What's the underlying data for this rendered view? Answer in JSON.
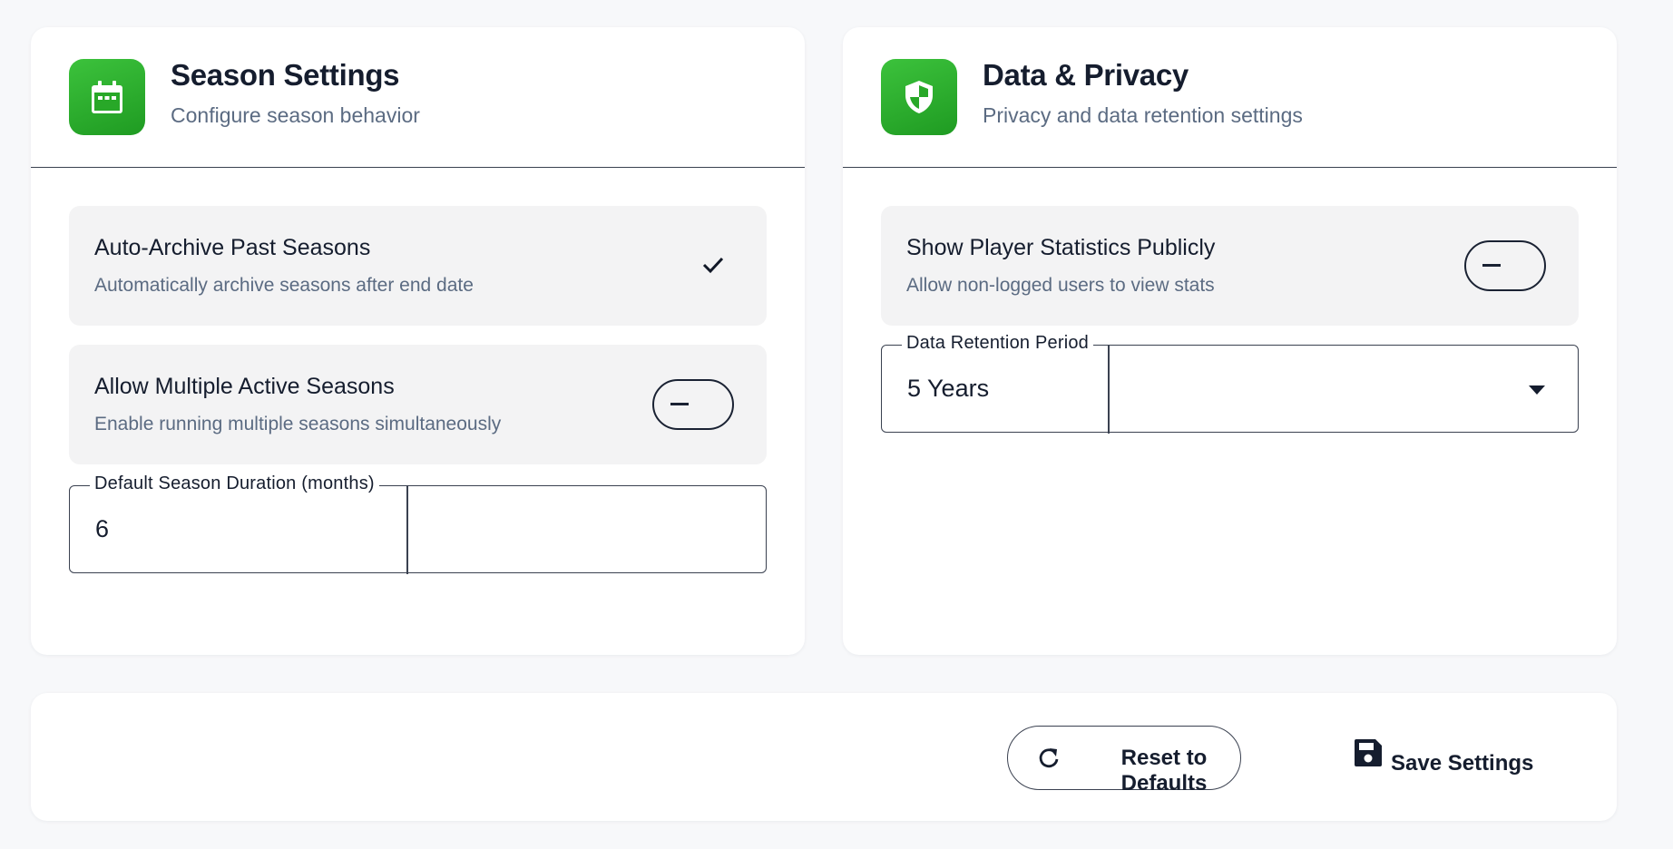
{
  "season_settings": {
    "title": "Season Settings",
    "subtitle": "Configure season behavior",
    "icon": "calendar-icon",
    "auto_archive": {
      "label": "Auto-Archive Past Seasons",
      "description": "Automatically archive seasons after end date",
      "checked": true
    },
    "multiple_active": {
      "label": "Allow Multiple Active Seasons",
      "description": "Enable running multiple seasons simultaneously",
      "enabled": false
    },
    "duration": {
      "label": "Default Season Duration (months)",
      "value": "6"
    }
  },
  "data_privacy": {
    "title": "Data & Privacy",
    "subtitle": "Privacy and data retention settings",
    "icon": "shield-icon",
    "public_stats": {
      "label": "Show Player Statistics Publicly",
      "description": "Allow non-logged users to view stats",
      "enabled": false
    },
    "retention": {
      "label": "Data Retention Period",
      "value": "5 Years"
    }
  },
  "actions": {
    "reset_label": "Reset to Defaults",
    "save_label": "Save Settings"
  },
  "colors": {
    "accent_green": "#2db52d",
    "text_dark": "#151d2e",
    "text_muted": "#5b6b82",
    "row_bg": "#f3f3f4",
    "page_bg": "#f7f8fa"
  }
}
